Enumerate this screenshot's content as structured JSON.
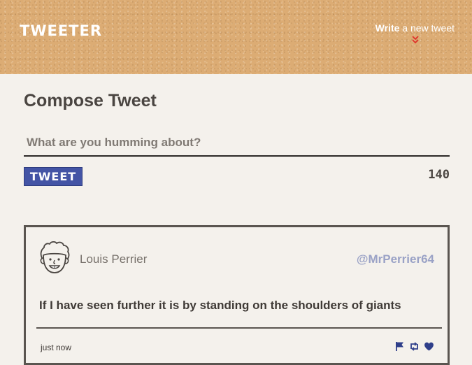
{
  "header": {
    "brand": "TWEETER",
    "write_bold": "Write",
    "write_rest": " a new tweet",
    "icons": {
      "toggle": "chevrons-down-icon"
    },
    "colors": {
      "background": "#dcac74",
      "chevron": "#e0322a"
    }
  },
  "compose": {
    "title": "Compose Tweet",
    "input_placeholder": "What are you humming about?",
    "input_value": "",
    "button_label": "TWEET",
    "counter": "140",
    "colors": {
      "button": "#4354a5"
    }
  },
  "tweets": [
    {
      "author": "Louis Perrier",
      "handle": "@MrPerrier64",
      "text": "If I have seen further it is by standing on the shoulders of giants",
      "time": "just now",
      "avatar_icon": "avatar-icon",
      "actions": [
        "flag-icon",
        "retweet-icon",
        "heart-icon"
      ],
      "colors": {
        "handle": "#9aa2c6",
        "actions": "#2f3f8a"
      }
    }
  ]
}
